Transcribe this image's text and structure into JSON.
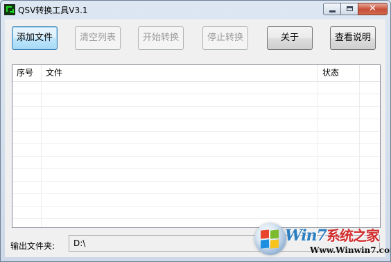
{
  "window": {
    "title": "QSV转换工具V3.1",
    "controls": [
      "minimize",
      "maximize",
      "close"
    ]
  },
  "toolbar": {
    "buttons": [
      {
        "id": "add-file",
        "label": "添加文件",
        "enabled": true
      },
      {
        "id": "clear-list",
        "label": "清空列表",
        "enabled": false
      },
      {
        "id": "start-convert",
        "label": "开始转换",
        "enabled": false
      },
      {
        "id": "stop-convert",
        "label": "停止转换",
        "enabled": false
      },
      {
        "id": "about",
        "label": "关于",
        "enabled": true
      },
      {
        "id": "view-help",
        "label": "查看说明",
        "enabled": true
      }
    ]
  },
  "file_list": {
    "columns": [
      "序号",
      "文件",
      "状态"
    ],
    "rows": []
  },
  "output": {
    "label": "输出文件夹:",
    "value": "D:\\"
  },
  "watermark": {
    "brand": "Win7",
    "brand_cn": "系统之家",
    "url": "Www.Winwin7.com"
  },
  "colors": {
    "accent_button": "#bee6fd",
    "close_button": "#c74d37"
  }
}
